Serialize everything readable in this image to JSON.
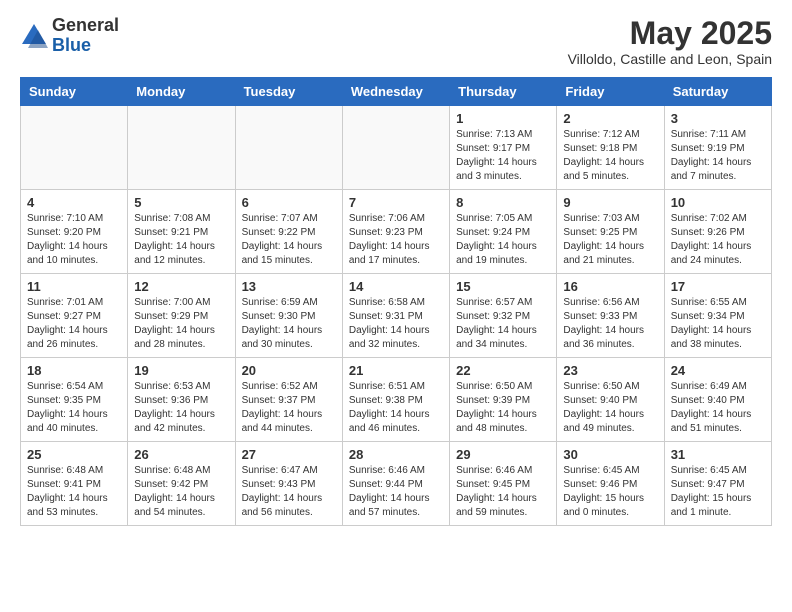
{
  "header": {
    "logo_general": "General",
    "logo_blue": "Blue",
    "month_title": "May 2025",
    "location": "Villoldo, Castille and Leon, Spain"
  },
  "days_of_week": [
    "Sunday",
    "Monday",
    "Tuesday",
    "Wednesday",
    "Thursday",
    "Friday",
    "Saturday"
  ],
  "weeks": [
    [
      {
        "day": "",
        "info": ""
      },
      {
        "day": "",
        "info": ""
      },
      {
        "day": "",
        "info": ""
      },
      {
        "day": "",
        "info": ""
      },
      {
        "day": "1",
        "info": "Sunrise: 7:13 AM\nSunset: 9:17 PM\nDaylight: 14 hours\nand 3 minutes."
      },
      {
        "day": "2",
        "info": "Sunrise: 7:12 AM\nSunset: 9:18 PM\nDaylight: 14 hours\nand 5 minutes."
      },
      {
        "day": "3",
        "info": "Sunrise: 7:11 AM\nSunset: 9:19 PM\nDaylight: 14 hours\nand 7 minutes."
      }
    ],
    [
      {
        "day": "4",
        "info": "Sunrise: 7:10 AM\nSunset: 9:20 PM\nDaylight: 14 hours\nand 10 minutes."
      },
      {
        "day": "5",
        "info": "Sunrise: 7:08 AM\nSunset: 9:21 PM\nDaylight: 14 hours\nand 12 minutes."
      },
      {
        "day": "6",
        "info": "Sunrise: 7:07 AM\nSunset: 9:22 PM\nDaylight: 14 hours\nand 15 minutes."
      },
      {
        "day": "7",
        "info": "Sunrise: 7:06 AM\nSunset: 9:23 PM\nDaylight: 14 hours\nand 17 minutes."
      },
      {
        "day": "8",
        "info": "Sunrise: 7:05 AM\nSunset: 9:24 PM\nDaylight: 14 hours\nand 19 minutes."
      },
      {
        "day": "9",
        "info": "Sunrise: 7:03 AM\nSunset: 9:25 PM\nDaylight: 14 hours\nand 21 minutes."
      },
      {
        "day": "10",
        "info": "Sunrise: 7:02 AM\nSunset: 9:26 PM\nDaylight: 14 hours\nand 24 minutes."
      }
    ],
    [
      {
        "day": "11",
        "info": "Sunrise: 7:01 AM\nSunset: 9:27 PM\nDaylight: 14 hours\nand 26 minutes."
      },
      {
        "day": "12",
        "info": "Sunrise: 7:00 AM\nSunset: 9:29 PM\nDaylight: 14 hours\nand 28 minutes."
      },
      {
        "day": "13",
        "info": "Sunrise: 6:59 AM\nSunset: 9:30 PM\nDaylight: 14 hours\nand 30 minutes."
      },
      {
        "day": "14",
        "info": "Sunrise: 6:58 AM\nSunset: 9:31 PM\nDaylight: 14 hours\nand 32 minutes."
      },
      {
        "day": "15",
        "info": "Sunrise: 6:57 AM\nSunset: 9:32 PM\nDaylight: 14 hours\nand 34 minutes."
      },
      {
        "day": "16",
        "info": "Sunrise: 6:56 AM\nSunset: 9:33 PM\nDaylight: 14 hours\nand 36 minutes."
      },
      {
        "day": "17",
        "info": "Sunrise: 6:55 AM\nSunset: 9:34 PM\nDaylight: 14 hours\nand 38 minutes."
      }
    ],
    [
      {
        "day": "18",
        "info": "Sunrise: 6:54 AM\nSunset: 9:35 PM\nDaylight: 14 hours\nand 40 minutes."
      },
      {
        "day": "19",
        "info": "Sunrise: 6:53 AM\nSunset: 9:36 PM\nDaylight: 14 hours\nand 42 minutes."
      },
      {
        "day": "20",
        "info": "Sunrise: 6:52 AM\nSunset: 9:37 PM\nDaylight: 14 hours\nand 44 minutes."
      },
      {
        "day": "21",
        "info": "Sunrise: 6:51 AM\nSunset: 9:38 PM\nDaylight: 14 hours\nand 46 minutes."
      },
      {
        "day": "22",
        "info": "Sunrise: 6:50 AM\nSunset: 9:39 PM\nDaylight: 14 hours\nand 48 minutes."
      },
      {
        "day": "23",
        "info": "Sunrise: 6:50 AM\nSunset: 9:40 PM\nDaylight: 14 hours\nand 49 minutes."
      },
      {
        "day": "24",
        "info": "Sunrise: 6:49 AM\nSunset: 9:40 PM\nDaylight: 14 hours\nand 51 minutes."
      }
    ],
    [
      {
        "day": "25",
        "info": "Sunrise: 6:48 AM\nSunset: 9:41 PM\nDaylight: 14 hours\nand 53 minutes."
      },
      {
        "day": "26",
        "info": "Sunrise: 6:48 AM\nSunset: 9:42 PM\nDaylight: 14 hours\nand 54 minutes."
      },
      {
        "day": "27",
        "info": "Sunrise: 6:47 AM\nSunset: 9:43 PM\nDaylight: 14 hours\nand 56 minutes."
      },
      {
        "day": "28",
        "info": "Sunrise: 6:46 AM\nSunset: 9:44 PM\nDaylight: 14 hours\nand 57 minutes."
      },
      {
        "day": "29",
        "info": "Sunrise: 6:46 AM\nSunset: 9:45 PM\nDaylight: 14 hours\nand 59 minutes."
      },
      {
        "day": "30",
        "info": "Sunrise: 6:45 AM\nSunset: 9:46 PM\nDaylight: 15 hours\nand 0 minutes."
      },
      {
        "day": "31",
        "info": "Sunrise: 6:45 AM\nSunset: 9:47 PM\nDaylight: 15 hours\nand 1 minute."
      }
    ]
  ]
}
